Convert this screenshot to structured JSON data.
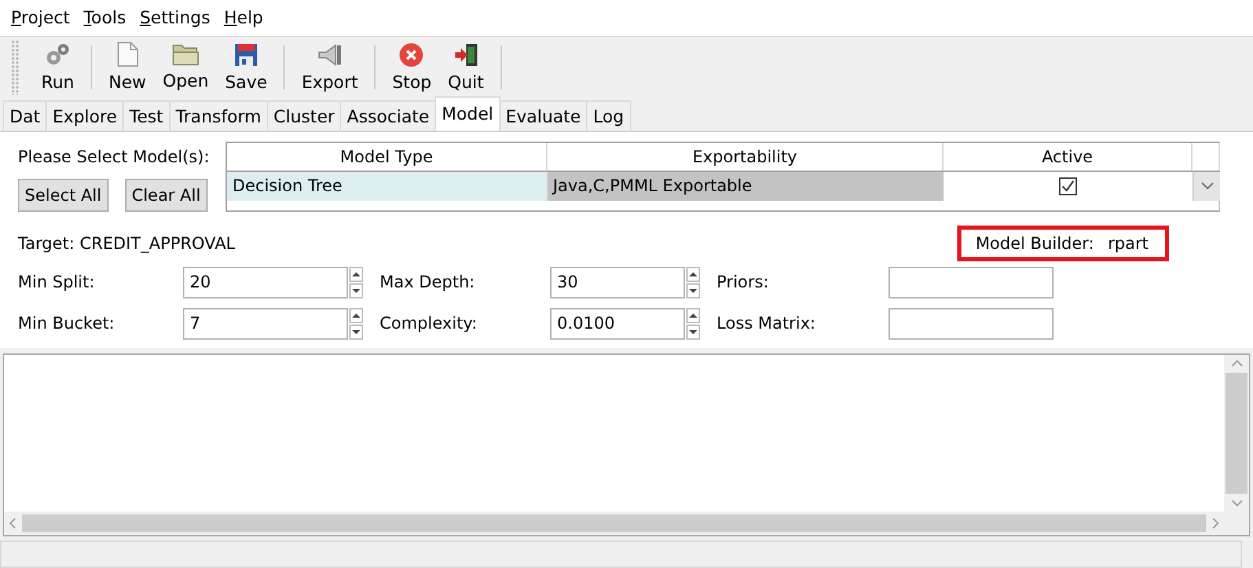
{
  "menu": [
    {
      "label": "Project"
    },
    {
      "label": "Tools"
    },
    {
      "label": "Settings"
    },
    {
      "label": "Help"
    }
  ],
  "toolbar_groups": [
    [
      {
        "label": "Run",
        "kind": "run"
      }
    ],
    [
      {
        "label": "New",
        "kind": "new"
      },
      {
        "label": "Open",
        "kind": "open"
      },
      {
        "label": "Save",
        "kind": "save"
      }
    ],
    [
      {
        "label": "Export",
        "kind": "export"
      }
    ],
    [
      {
        "label": "Stop",
        "kind": "stop"
      },
      {
        "label": "Quit",
        "kind": "quit"
      }
    ]
  ],
  "tabs": [
    {
      "label": "Dat",
      "selected": false
    },
    {
      "label": "Explore",
      "selected": false
    },
    {
      "label": "Test",
      "selected": false
    },
    {
      "label": "Transform",
      "selected": false
    },
    {
      "label": "Cluster",
      "selected": false
    },
    {
      "label": "Associate",
      "selected": false
    },
    {
      "label": "Model",
      "selected": true
    },
    {
      "label": "Evaluate",
      "selected": false
    },
    {
      "label": "Log",
      "selected": false
    }
  ],
  "model_select": {
    "prompt": "Please Select Model(s):",
    "buttons": [
      "Select All",
      "Clear All"
    ]
  },
  "models_table": {
    "columns": [
      "Model Type",
      "Exportability",
      "Active"
    ],
    "rows": [
      {
        "model_type": "Decision Tree",
        "exportability": "Java,C,PMML Exportable",
        "active": true
      }
    ]
  },
  "target": "Target: CREDIT_APPROVAL",
  "model_builder": {
    "label": "Model Builder:",
    "value": "rpart",
    "highlighted": true
  },
  "parameters": [
    {
      "label": "Min Split:",
      "value": "20",
      "kind": "spin"
    },
    {
      "label": "Max Depth:",
      "value": "30",
      "kind": "spin"
    },
    {
      "label": "Priors:",
      "kind": "text"
    },
    {
      "label": "Min Bucket:",
      "value": "7",
      "kind": "spin"
    },
    {
      "label": "Complexity:",
      "value": "0.0100",
      "kind": "spin"
    },
    {
      "label": "Loss Matrix:",
      "kind": "text"
    }
  ]
}
